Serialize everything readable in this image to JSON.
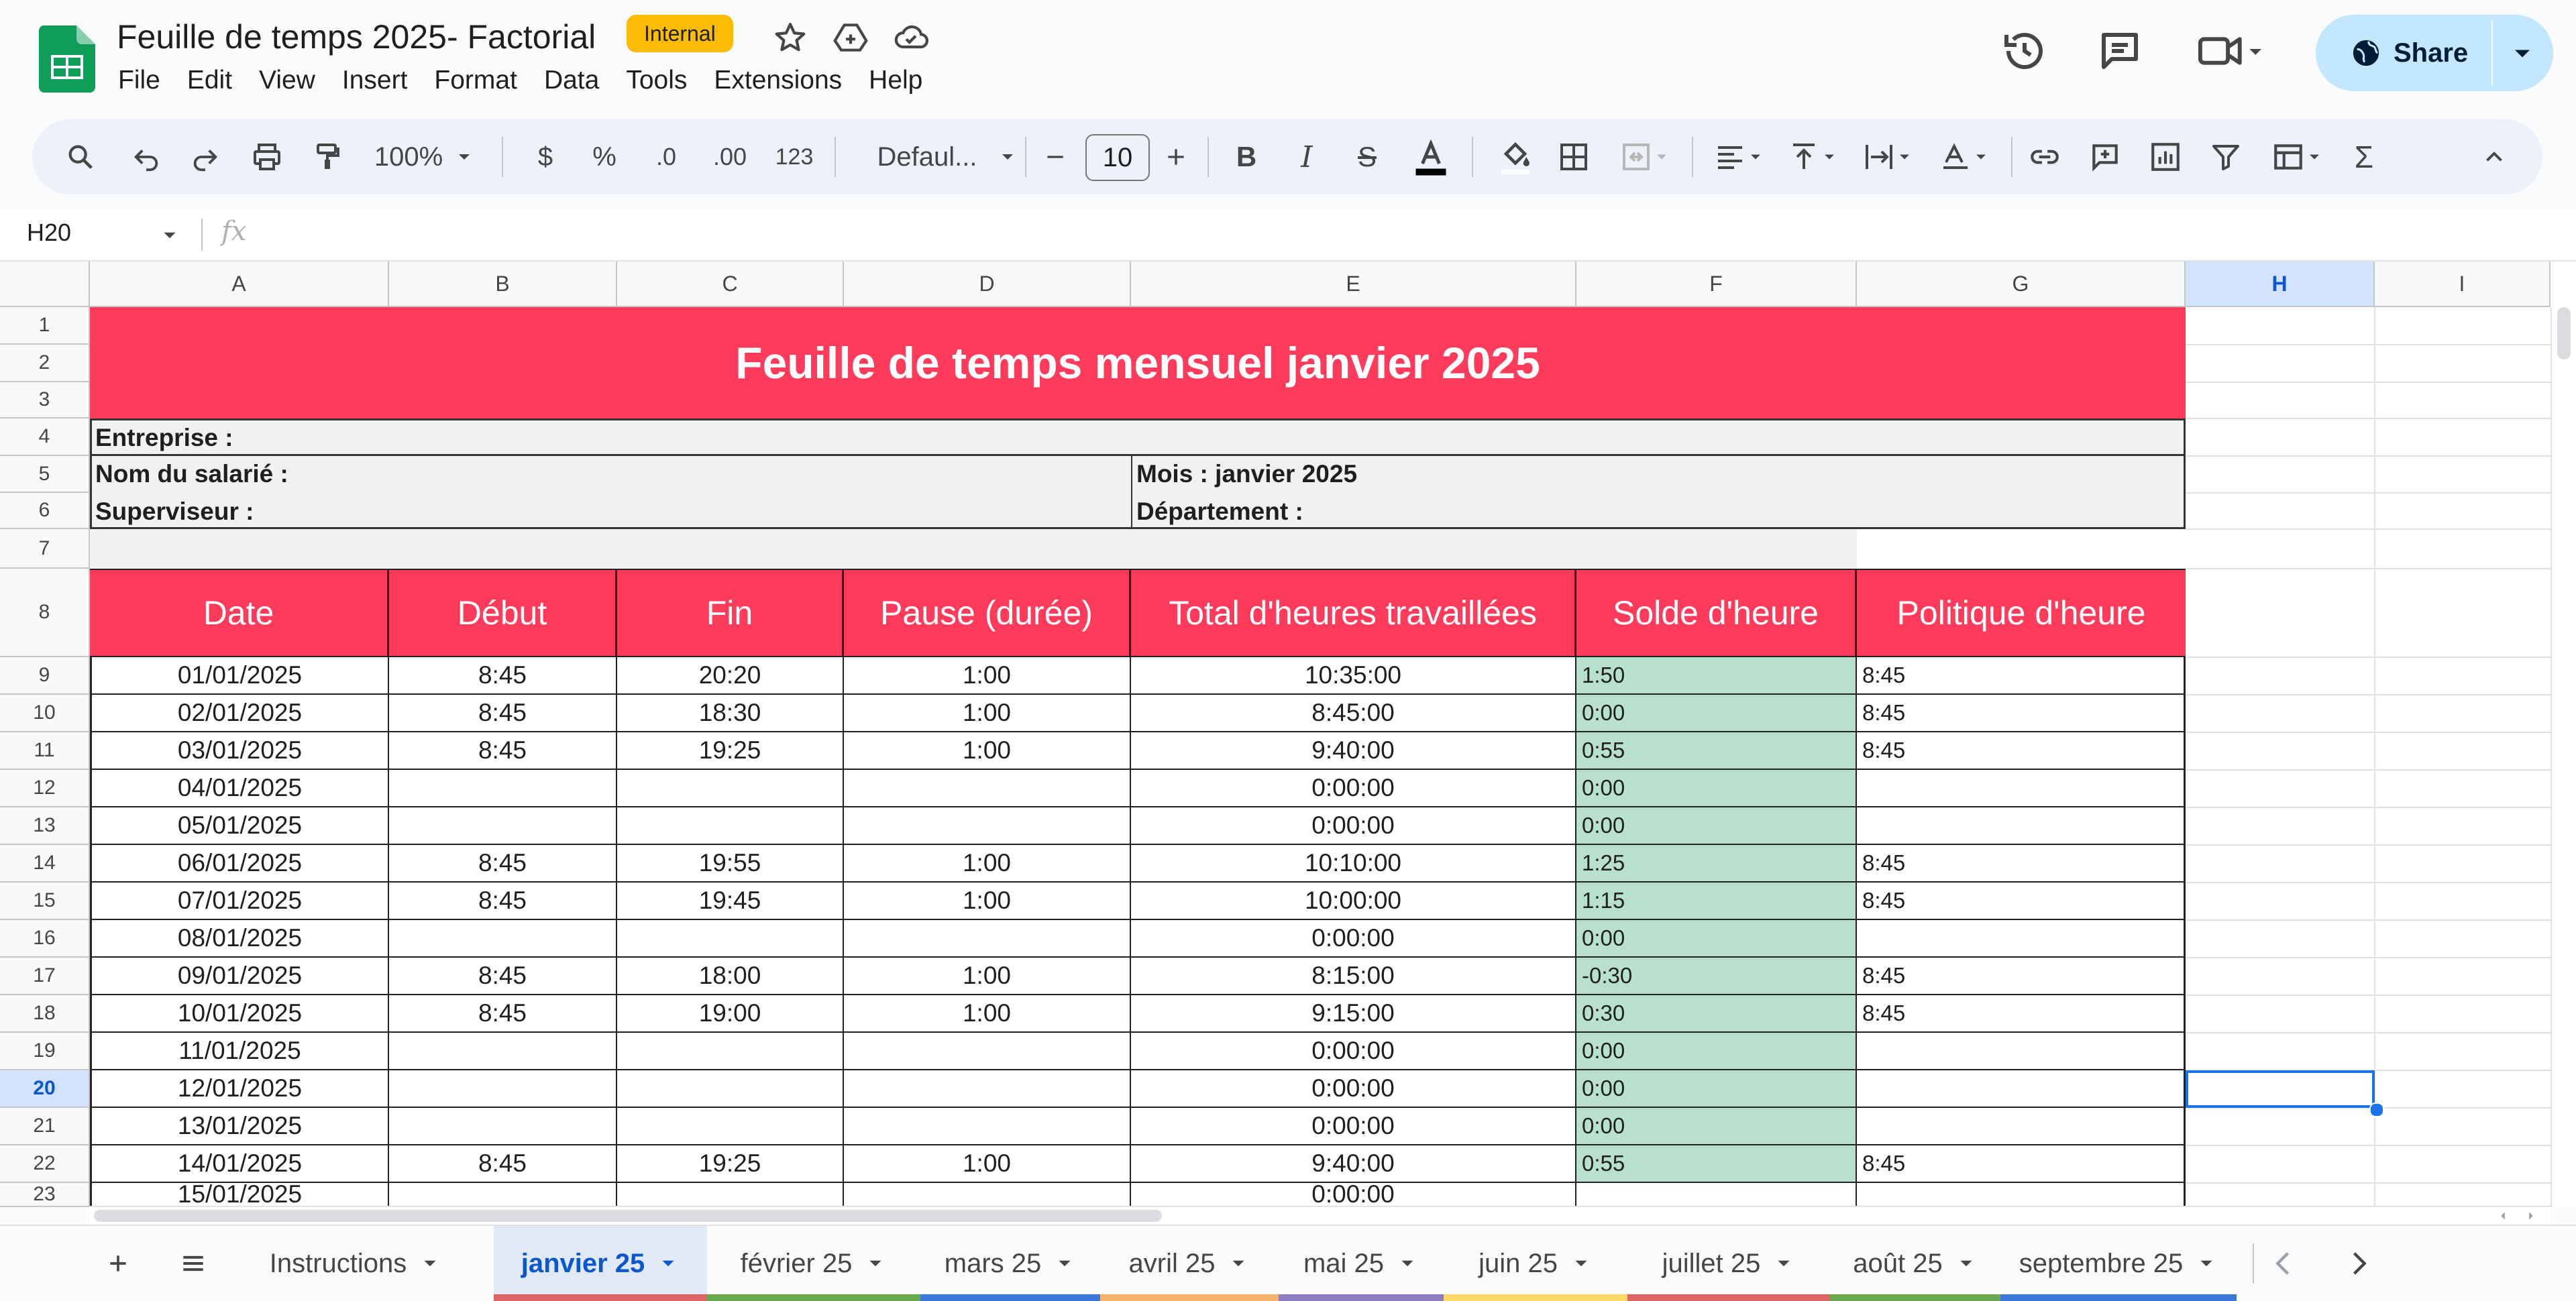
{
  "app": {
    "title": "Feuille de temps 2025- Factorial",
    "badge": "Internal",
    "menu": [
      "File",
      "Edit",
      "View",
      "Insert",
      "Format",
      "Data",
      "Tools",
      "Extensions",
      "Help"
    ],
    "share_label": "Share"
  },
  "toolbar": {
    "zoom": "100%",
    "currency": "$",
    "percent": "%",
    "dec_decrease": ".0",
    "dec_increase": ".00",
    "number_format": "123",
    "font": "Defaul...",
    "font_size": "10"
  },
  "formula_bar": {
    "cell_ref": "H20",
    "fx": "fx",
    "value": ""
  },
  "columns": [
    "A",
    "B",
    "C",
    "D",
    "E",
    "F",
    "G",
    "H",
    "I"
  ],
  "selected_column": "H",
  "selected_row": "20",
  "rows": [
    "1",
    "2",
    "3",
    "4",
    "5",
    "6",
    "7",
    "8",
    "9",
    "10",
    "11",
    "12",
    "13",
    "14",
    "15",
    "16",
    "17",
    "18",
    "19",
    "20",
    "21",
    "22",
    "23"
  ],
  "sheet": {
    "title": "Feuille de temps mensuel janvier 2025",
    "company_label": "Entreprise :",
    "employee_label": "Nom du salarié :",
    "supervisor_label": "Superviseur :",
    "month_label": "Mois : janvier 2025",
    "department_label": "Département :",
    "headers": [
      "Date",
      "Début",
      "Fin",
      "Pause (durée)",
      "Total d'heures travaillées",
      "Solde d'heure",
      "Politique d'heure"
    ],
    "data": [
      [
        "01/01/2025",
        "8:45",
        "20:20",
        "1:00",
        "10:35:00",
        "1:50",
        "8:45"
      ],
      [
        "02/01/2025",
        "8:45",
        "18:30",
        "1:00",
        "8:45:00",
        "0:00",
        "8:45"
      ],
      [
        "03/01/2025",
        "8:45",
        "19:25",
        "1:00",
        "9:40:00",
        "0:55",
        "8:45"
      ],
      [
        "04/01/2025",
        "",
        "",
        "",
        "0:00:00",
        "0:00",
        ""
      ],
      [
        "05/01/2025",
        "",
        "",
        "",
        "0:00:00",
        "0:00",
        ""
      ],
      [
        "06/01/2025",
        "8:45",
        "19:55",
        "1:00",
        "10:10:00",
        "1:25",
        "8:45"
      ],
      [
        "07/01/2025",
        "8:45",
        "19:45",
        "1:00",
        "10:00:00",
        "1:15",
        "8:45"
      ],
      [
        "08/01/2025",
        "",
        "",
        "",
        "0:00:00",
        "0:00",
        ""
      ],
      [
        "09/01/2025",
        "8:45",
        "18:00",
        "1:00",
        "8:15:00",
        "-0:30",
        "8:45"
      ],
      [
        "10/01/2025",
        "8:45",
        "19:00",
        "1:00",
        "9:15:00",
        "0:30",
        "8:45"
      ],
      [
        "11/01/2025",
        "",
        "",
        "",
        "0:00:00",
        "0:00",
        ""
      ],
      [
        "12/01/2025",
        "",
        "",
        "",
        "0:00:00",
        "0:00",
        ""
      ],
      [
        "13/01/2025",
        "",
        "",
        "",
        "0:00:00",
        "0:00",
        ""
      ],
      [
        "14/01/2025",
        "8:45",
        "19:25",
        "1:00",
        "9:40:00",
        "0:55",
        "8:45"
      ],
      [
        "15/01/2025",
        "",
        "",
        "",
        "0:00:00",
        "",
        ""
      ]
    ]
  },
  "tabs": [
    {
      "label": "Instructions",
      "color": ""
    },
    {
      "label": "janvier 25",
      "color": "#e06666"
    },
    {
      "label": "février 25",
      "color": "#6aa84f"
    },
    {
      "label": "mars 25",
      "color": "#3c78d8"
    },
    {
      "label": "avril 25",
      "color": "#f6b26b"
    },
    {
      "label": "mai 25",
      "color": "#8e7cc3"
    },
    {
      "label": "juin 25",
      "color": "#ffd966"
    },
    {
      "label": "juillet 25",
      "color": "#e06666"
    },
    {
      "label": "août 25",
      "color": "#6aa84f"
    },
    {
      "label": "septembre 25",
      "color": "#3c78d8"
    }
  ],
  "colors": {
    "header_bg": "#ff3b5c",
    "balance_bg": "#b7e1cd",
    "info_bg": "#f3f1ef",
    "selection": "#1a73e8"
  }
}
